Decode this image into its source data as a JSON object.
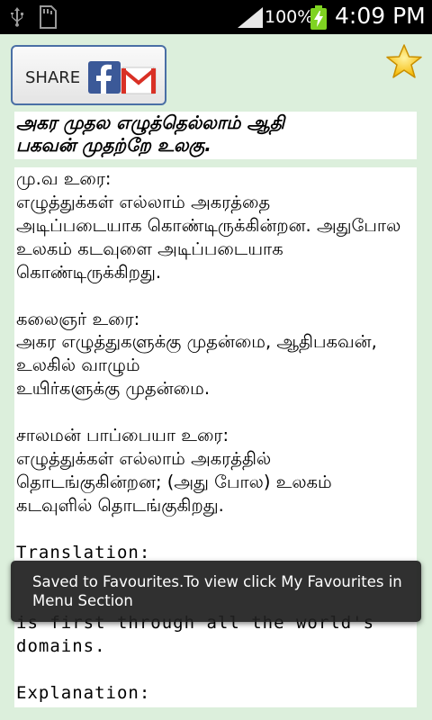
{
  "status_bar": {
    "battery_percent": "100%",
    "time": "4:09 PM",
    "icons": [
      "usb-icon",
      "sd-card-icon",
      "signal-icon",
      "battery-charging-icon"
    ]
  },
  "share_button": {
    "label": "SHARE",
    "icons": [
      "facebook-icon",
      "gmail-icon"
    ]
  },
  "favourite_icon": "star-icon",
  "kural": {
    "line1": "அகர முதல எழுத்தெல்லாம் ஆதி",
    "line2": "பகவன் முதற்றே உலகு."
  },
  "mu_va": {
    "heading": "மு.வ உரை:",
    "lines": [
      "எழுத்துக்கள் எல்லாம் அகரத்தை",
      "அடிப்படையாக கொண்டிருக்கின்றன. அதுபோல",
      "உலகம் கடவுளை அடிப்படையாக",
      "கொண்டிருக்கிறது."
    ]
  },
  "kalaignar": {
    "heading": "கலைஞர் உரை:",
    "lines": [
      "அகர எழுத்துகளுக்கு முதன்மை, ஆதிபகவன்,",
      "உலகில் வாழும்",
      "உயிர்களுக்கு முதன்மை."
    ]
  },
  "salaman": {
    "heading": "சாலமன் பாப்பையா உரை:",
    "lines": [
      "எழுத்துக்கள் எல்லாம் அகரத்தில்",
      "தொடங்குகின்றன; (அது போல) உலகம்",
      "கடவுளில் தொடங்குகிறது."
    ]
  },
  "translation": {
    "heading": "Translation:",
    "lines": [
      "is first through all the world's",
      "domains."
    ]
  },
  "explanation": {
    "heading": "Explanation:"
  },
  "toast": {
    "message": "Saved to Favourites.To view click My Favourites in Menu Section"
  },
  "colors": {
    "background": "#dcefdc",
    "panel": "#ffffff",
    "toast_bg": "#202020",
    "share_border": "#4a6fa5",
    "facebook_blue": "#3b5998",
    "gmail_red": "#d93025",
    "star_gold": "#f5b800"
  }
}
